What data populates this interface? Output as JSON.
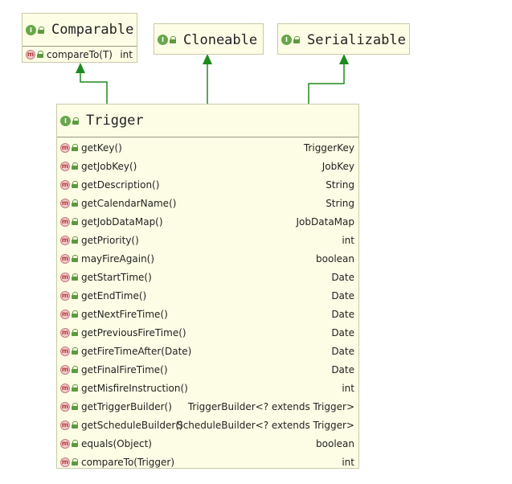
{
  "interfaces": {
    "comparable": {
      "name": "Comparable",
      "methods": [
        {
          "name": "compareTo(T)",
          "type": "int"
        }
      ]
    },
    "cloneable": {
      "name": "Cloneable"
    },
    "serializable": {
      "name": "Serializable"
    }
  },
  "trigger": {
    "name": "Trigger",
    "methods": [
      {
        "name": "getKey()",
        "type": "TriggerKey"
      },
      {
        "name": "getJobKey()",
        "type": "JobKey"
      },
      {
        "name": "getDescription()",
        "type": "String"
      },
      {
        "name": "getCalendarName()",
        "type": "String"
      },
      {
        "name": "getJobDataMap()",
        "type": "JobDataMap"
      },
      {
        "name": "getPriority()",
        "type": "int"
      },
      {
        "name": "mayFireAgain()",
        "type": "boolean"
      },
      {
        "name": "getStartTime()",
        "type": "Date"
      },
      {
        "name": "getEndTime()",
        "type": "Date"
      },
      {
        "name": "getNextFireTime()",
        "type": "Date"
      },
      {
        "name": "getPreviousFireTime()",
        "type": "Date"
      },
      {
        "name": "getFireTimeAfter(Date)",
        "type": "Date"
      },
      {
        "name": "getFinalFireTime()",
        "type": "Date"
      },
      {
        "name": "getMisfireInstruction()",
        "type": "int"
      },
      {
        "name": "getTriggerBuilder()",
        "type": "TriggerBuilder<? extends Trigger>"
      },
      {
        "name": "getScheduleBuilder()",
        "type": "ScheduleBuilder<? extends Trigger>"
      },
      {
        "name": "equals(Object)",
        "type": "boolean"
      },
      {
        "name": "compareTo(Trigger)",
        "type": "int"
      }
    ]
  },
  "badges": {
    "interface": "I",
    "method": "m"
  },
  "icons": {
    "interface": "interface-icon",
    "method": "method-icon",
    "visibility": "lock-icon"
  },
  "colors": {
    "box_fill": "#fdfde6",
    "arrow": "#1f8a1f",
    "badge_green": "#67a74b",
    "method_badge": "#f4c9c9"
  }
}
